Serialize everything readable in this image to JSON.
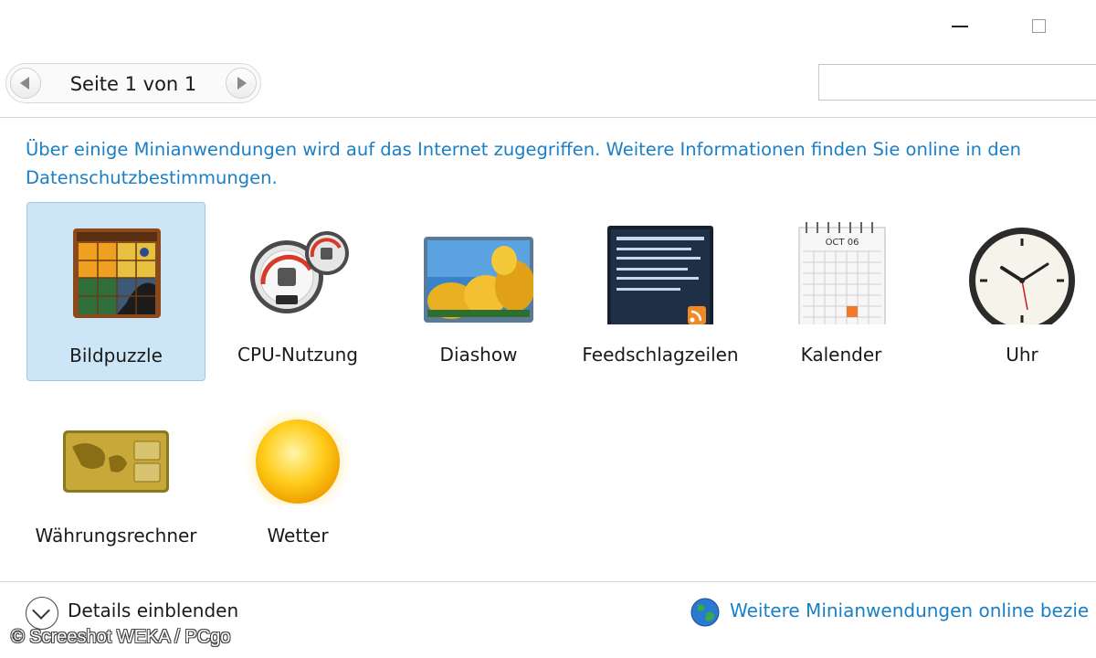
{
  "window": {
    "minimize_icon": "minimize-icon",
    "maximize_icon": "maximize-icon"
  },
  "pager": {
    "label": "Seite 1 von 1",
    "prev_icon": "chevron-left-icon",
    "next_icon": "chevron-right-icon"
  },
  "search": {
    "value": "",
    "placeholder": ""
  },
  "info_text": "Über einige Minianwendungen wird auf das Internet zugegriffen. Weitere Informationen finden Sie online in den Datenschutzbestimmungen.",
  "gadgets": [
    {
      "label": "Bildpuzzle",
      "icon": "picture-puzzle-icon",
      "selected": true
    },
    {
      "label": "CPU-Nutzung",
      "icon": "cpu-meter-icon",
      "selected": false
    },
    {
      "label": "Diashow",
      "icon": "slideshow-icon",
      "selected": false
    },
    {
      "label": "Feedschlagzeilen",
      "icon": "feed-headlines-icon",
      "selected": false
    },
    {
      "label": "Kalender",
      "icon": "calendar-icon",
      "selected": false
    },
    {
      "label": "Uhr",
      "icon": "clock-icon",
      "selected": false
    },
    {
      "label": "Währungsrechner",
      "icon": "currency-icon",
      "selected": false
    },
    {
      "label": "Wetter",
      "icon": "weather-sun-icon",
      "selected": false
    }
  ],
  "calendar_icon": {
    "month": "OCT 06"
  },
  "footer": {
    "details_label": "Details einblenden",
    "details_icon": "chevron-down-icon",
    "online_link": "Weitere Minianwendungen online bezie",
    "globe_icon": "globe-icon"
  },
  "watermark": "© Screeshot WEKA / PCgo",
  "colors": {
    "link": "#1b7fc5",
    "selection": "#cde6f7",
    "selection_border": "#99c9ec"
  }
}
